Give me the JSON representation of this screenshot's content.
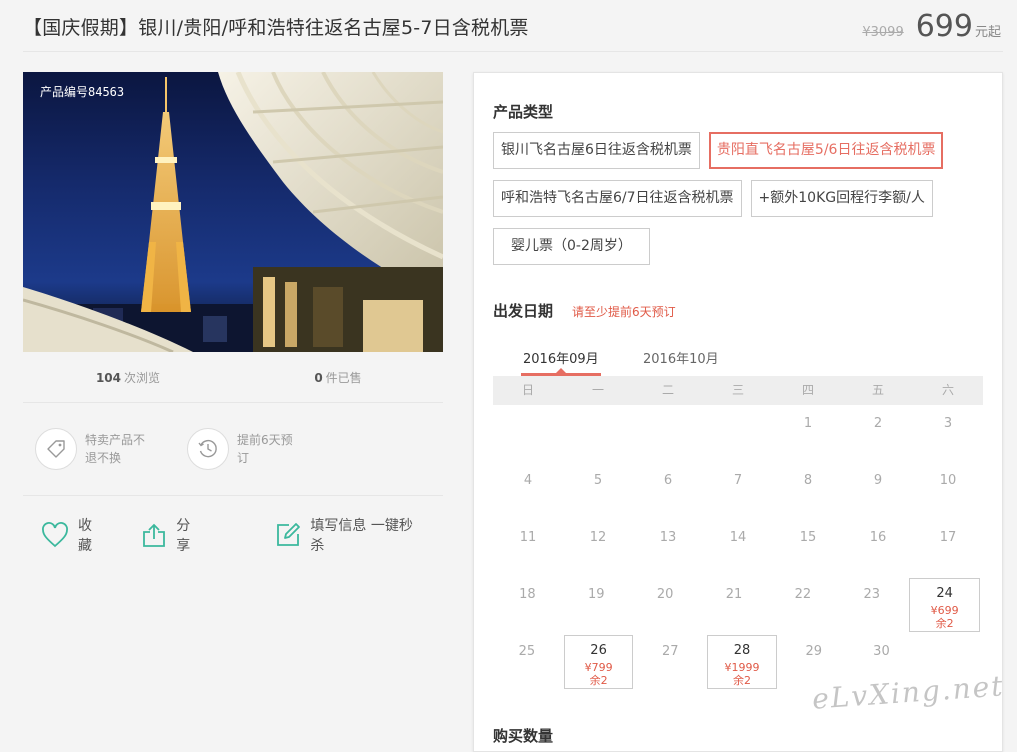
{
  "header": {
    "title": "【国庆假期】银川/贵阳/呼和浩特往返名古屋5-7日含税机票",
    "old_price": "¥3099",
    "price": "699",
    "price_unit": "元起"
  },
  "product": {
    "id_label": "产品编号84563",
    "views_count": "104",
    "views_label": "次浏览",
    "sold_count": "0",
    "sold_label": "件已售"
  },
  "features": [
    {
      "icon": "tag-icon",
      "text": "特卖产品不退不换"
    },
    {
      "icon": "clock-icon",
      "text": "提前6天预订"
    }
  ],
  "actions": {
    "favorite": "收藏",
    "share": "分享",
    "fill_info": "填写信息 一键秒杀"
  },
  "product_type": {
    "title": "产品类型",
    "options": [
      {
        "label": "银川飞名古屋6日往返含税机票",
        "selected": false
      },
      {
        "label": "贵阳直飞名古屋5/6日往返含税机票",
        "selected": true
      },
      {
        "label": "呼和浩特飞名古屋6/7日往返含税机票",
        "selected": false
      },
      {
        "label": "+额外10KG回程行李额/人",
        "selected": false
      },
      {
        "label": "婴儿票（0-2周岁）",
        "selected": false
      }
    ]
  },
  "departure": {
    "title": "出发日期",
    "hint": "请至少提前6天预订",
    "months": [
      "2016年09月",
      "2016年10月"
    ],
    "active_month": 0,
    "weekdays": [
      "日",
      "一",
      "二",
      "三",
      "四",
      "五",
      "六"
    ],
    "weeks": [
      [
        null,
        null,
        null,
        null,
        {
          "day": "1"
        },
        {
          "day": "2"
        },
        {
          "day": "3"
        }
      ],
      [
        {
          "day": "4"
        },
        {
          "day": "5"
        },
        {
          "day": "6"
        },
        {
          "day": "7"
        },
        {
          "day": "8"
        },
        {
          "day": "9"
        },
        {
          "day": "10"
        }
      ],
      [
        {
          "day": "11"
        },
        {
          "day": "12"
        },
        {
          "day": "13"
        },
        {
          "day": "14"
        },
        {
          "day": "15"
        },
        {
          "day": "16"
        },
        {
          "day": "17"
        }
      ],
      [
        {
          "day": "18"
        },
        {
          "day": "19"
        },
        {
          "day": "20"
        },
        {
          "day": "21"
        },
        {
          "day": "22"
        },
        {
          "day": "23"
        },
        {
          "day": "24",
          "price": "¥699",
          "left": "余2"
        }
      ],
      [
        {
          "day": "25"
        },
        {
          "day": "26",
          "price": "¥799",
          "left": "余2"
        },
        {
          "day": "27"
        },
        {
          "day": "28",
          "price": "¥1999",
          "left": "余2"
        },
        {
          "day": "29"
        },
        {
          "day": "30"
        },
        null
      ]
    ]
  },
  "quantity": {
    "title": "购买数量"
  },
  "watermark": "eLvXing.net",
  "colors": {
    "accent": "#e66e62",
    "green_icon": "#3bb89d",
    "price_red": "#e05a47"
  }
}
